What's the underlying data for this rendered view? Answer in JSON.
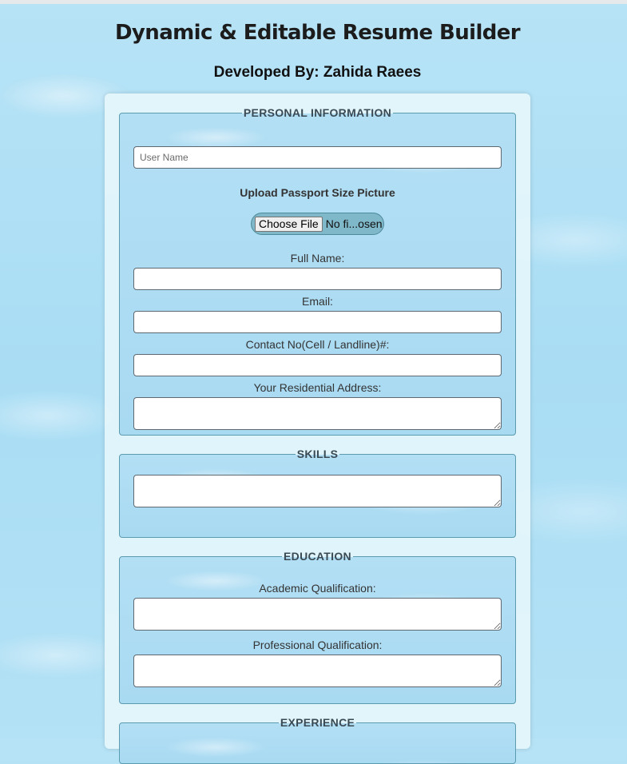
{
  "page": {
    "title": "Dynamic & Editable Resume Builder",
    "subtitle": "Developed By: Zahida Raees"
  },
  "personal": {
    "legend": "PERSONAL INFORMATION",
    "username_placeholder": "User Name",
    "username_value": "",
    "upload_label": "Upload Passport Size Picture",
    "file_button": "Choose File",
    "file_status": "No fi...osen",
    "full_name_label": "Full Name:",
    "full_name_value": "",
    "email_label": "Email:",
    "email_value": "",
    "contact_label": "Contact No(Cell / Landline)#:",
    "contact_value": "",
    "address_label": "Your Residential Address:",
    "address_value": ""
  },
  "skills": {
    "legend": "SKILLS",
    "value": ""
  },
  "education": {
    "legend": "EDUCATION",
    "academic_label": "Academic Qualification:",
    "academic_value": "",
    "professional_label": "Professional Qualification:",
    "professional_value": ""
  },
  "experience": {
    "legend": "EXPERIENCE"
  }
}
